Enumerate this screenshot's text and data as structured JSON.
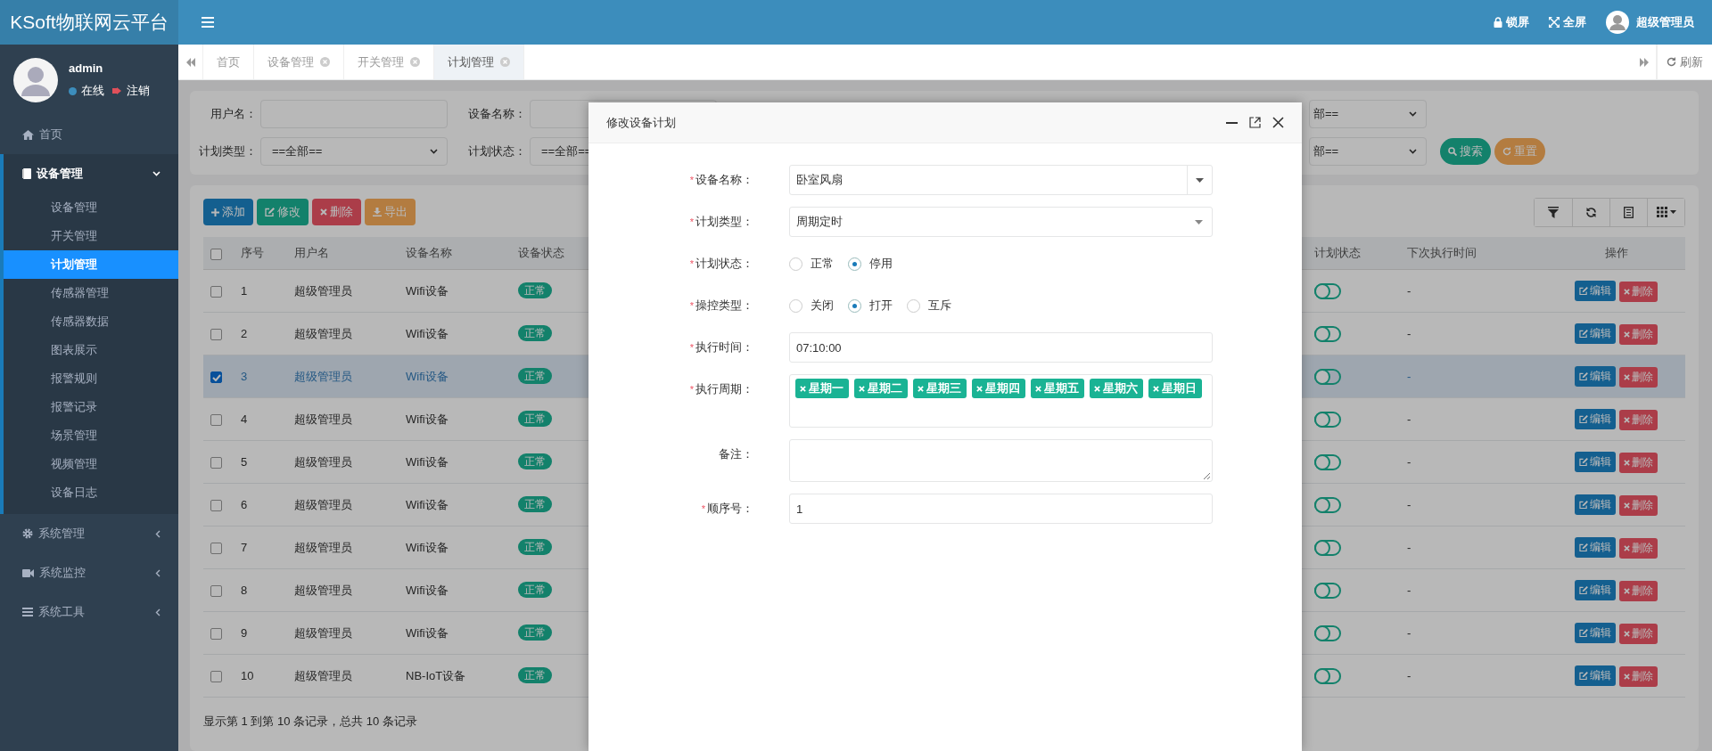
{
  "header": {
    "logo": "KSoft物联网云平台",
    "actions": [
      {
        "kind": "lock",
        "label": "锁屏"
      },
      {
        "kind": "fullscreen",
        "label": "全屏"
      }
    ],
    "user": "超级管理员"
  },
  "sidebar": {
    "user": {
      "name": "admin",
      "status": "在线",
      "logout": "注销"
    },
    "items": [
      {
        "kind": "link",
        "label": "首页"
      },
      {
        "kind": "group",
        "label": "设备管理",
        "expanded": true,
        "children": [
          {
            "label": "设备管理",
            "selected": false
          },
          {
            "label": "开关管理",
            "selected": false
          },
          {
            "label": "计划管理",
            "selected": true
          },
          {
            "label": "传感器管理",
            "selected": false
          },
          {
            "label": "传感器数据",
            "selected": false
          },
          {
            "label": "图表展示",
            "selected": false
          },
          {
            "label": "报警规则",
            "selected": false
          },
          {
            "label": "报警记录",
            "selected": false
          },
          {
            "label": "场景管理",
            "selected": false
          },
          {
            "label": "视频管理",
            "selected": false
          },
          {
            "label": "设备日志",
            "selected": false
          }
        ]
      },
      {
        "kind": "group",
        "label": "系统管理",
        "expanded": false
      },
      {
        "kind": "group",
        "label": "系统监控",
        "expanded": false
      },
      {
        "kind": "group",
        "label": "系统工具",
        "expanded": false
      }
    ]
  },
  "tabs": [
    {
      "label": "首页",
      "closable": false,
      "selected": false
    },
    {
      "label": "设备管理",
      "closable": true,
      "selected": false
    },
    {
      "label": "开关管理",
      "closable": true,
      "selected": false
    },
    {
      "label": "计划管理",
      "closable": true,
      "selected": true
    }
  ],
  "tabs_refresh": "刷新",
  "filters": {
    "rows": [
      [
        {
          "kind": "input",
          "label": "用户名："
        },
        {
          "kind": "input",
          "label": "设备名称："
        },
        {
          "kind": "select",
          "value": "部=="
        }
      ],
      [
        {
          "kind": "select",
          "label": "计划类型：",
          "value": "==全部=="
        },
        {
          "kind": "select",
          "label": "计划状态：",
          "value": "==全部=="
        },
        {
          "kind": "select",
          "value": "部=="
        }
      ]
    ],
    "buttons": [
      {
        "kind": "search",
        "label": "搜索"
      },
      {
        "kind": "reset",
        "label": "重置"
      }
    ]
  },
  "toolbar": [
    {
      "kind": "add",
      "label": "添加"
    },
    {
      "kind": "edit",
      "label": "修改"
    },
    {
      "kind": "delete",
      "label": "删除"
    },
    {
      "kind": "export",
      "label": "导出"
    }
  ],
  "toolbar_right": [
    {
      "kind": "filter"
    },
    {
      "kind": "refresh"
    },
    {
      "kind": "list"
    },
    {
      "kind": "columns"
    }
  ],
  "table": {
    "header_checked": false,
    "columns": [
      "序号",
      "用户名",
      "设备名称",
      "设备状态",
      "计划状态",
      "下次执行时间",
      "操作"
    ],
    "rows": [
      {
        "selected": false,
        "no": "1",
        "user": "超级管理员",
        "device": "Wifi设备",
        "status": "正常",
        "plan_on": false,
        "next_run": "-",
        "actions": [
          "编辑",
          "删除"
        ]
      },
      {
        "selected": false,
        "no": "2",
        "user": "超级管理员",
        "device": "Wifi设备",
        "status": "正常",
        "plan_on": false,
        "next_run": "-",
        "actions": [
          "编辑",
          "删除"
        ]
      },
      {
        "selected": true,
        "no": "3",
        "user": "超级管理员",
        "device": "Wifi设备",
        "status": "正常",
        "plan_on": false,
        "next_run": "-",
        "actions": [
          "编辑",
          "删除"
        ]
      },
      {
        "selected": false,
        "no": "4",
        "user": "超级管理员",
        "device": "Wifi设备",
        "status": "正常",
        "plan_on": false,
        "next_run": "-",
        "actions": [
          "编辑",
          "删除"
        ]
      },
      {
        "selected": false,
        "no": "5",
        "user": "超级管理员",
        "device": "Wifi设备",
        "status": "正常",
        "plan_on": false,
        "next_run": "-",
        "actions": [
          "编辑",
          "删除"
        ]
      },
      {
        "selected": false,
        "no": "6",
        "user": "超级管理员",
        "device": "Wifi设备",
        "status": "正常",
        "plan_on": false,
        "next_run": "-",
        "actions": [
          "编辑",
          "删除"
        ]
      },
      {
        "selected": false,
        "no": "7",
        "user": "超级管理员",
        "device": "Wifi设备",
        "status": "正常",
        "plan_on": false,
        "next_run": "-",
        "actions": [
          "编辑",
          "删除"
        ]
      },
      {
        "selected": false,
        "no": "8",
        "user": "超级管理员",
        "device": "Wifi设备",
        "status": "正常",
        "plan_on": false,
        "next_run": "-",
        "actions": [
          "编辑",
          "删除"
        ]
      },
      {
        "selected": false,
        "no": "9",
        "user": "超级管理员",
        "device": "Wifi设备",
        "status": "正常",
        "plan_on": false,
        "next_run": "-",
        "actions": [
          "编辑",
          "删除"
        ]
      },
      {
        "selected": false,
        "no": "10",
        "user": "超级管理员",
        "device": "NB-IoT设备",
        "status": "正常",
        "plan_on": false,
        "next_run": "-",
        "actions": [
          "编辑",
          "删除"
        ]
      }
    ],
    "footer": "显示第 1 到第 10 条记录，总共 10 条记录"
  },
  "modal": {
    "title": "修改设备计划",
    "fields": [
      {
        "kind": "combo",
        "required_mark": "*",
        "label": "设备名称：",
        "value": "卧室风扇"
      },
      {
        "kind": "select",
        "required_mark": "*",
        "label": "计划类型：",
        "value": "周期定时"
      },
      {
        "kind": "radio",
        "required_mark": "*",
        "label": "计划状态：",
        "options": [
          {
            "label": "正常",
            "selected": false
          },
          {
            "label": "停用",
            "selected": true
          }
        ]
      },
      {
        "kind": "radio",
        "required_mark": "*",
        "label": "操控类型：",
        "options": [
          {
            "label": "关闭",
            "selected": false
          },
          {
            "label": "打开",
            "selected": true
          },
          {
            "label": "互斥",
            "selected": false
          }
        ]
      },
      {
        "kind": "input",
        "required_mark": "*",
        "label": "执行时间：",
        "value": "07:10:00"
      },
      {
        "kind": "tags",
        "required_mark": "*",
        "label": "执行周期：",
        "tags": [
          "星期一",
          "星期二",
          "星期三",
          "星期四",
          "星期五",
          "星期六",
          "星期日"
        ]
      },
      {
        "kind": "textarea",
        "label": "备注："
      },
      {
        "kind": "input",
        "required_mark": "*",
        "label": "顺序号：",
        "value": "1"
      }
    ]
  }
}
